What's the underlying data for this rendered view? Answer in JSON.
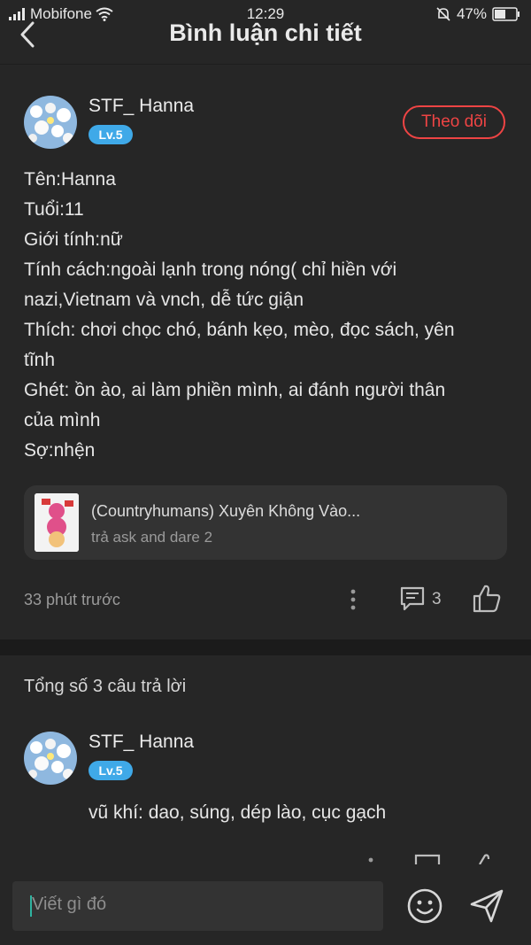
{
  "status_bar": {
    "carrier": "Mobifone",
    "time": "12:29",
    "battery": "47%"
  },
  "header": {
    "title": "Bình luận chi tiết"
  },
  "comment": {
    "user": {
      "name": "STF_ Hanna",
      "level": "Lv.5"
    },
    "follow_label": "Theo dõi",
    "lines": [
      "Tên:Hanna",
      "Tuổi:11",
      "Giới tính:nữ",
      "Tính cách:ngoài lạnh trong nóng( chỉ hiền với",
      "nazi,Vietnam và vnch, dễ tức giận",
      "Thích: chơi chọc chó, bánh kẹo, mèo, đọc sách, yên",
      "tĩnh",
      "Ghét: ồn ào, ai làm phiền mình, ai đánh người thân",
      "của mình",
      "Sợ:nhện"
    ],
    "story_card": {
      "title": "(Countryhumans) Xuyên Không Vào...",
      "subtitle": "trả ask and dare 2"
    },
    "time": "33 phút trước",
    "comment_count": "3"
  },
  "replies": {
    "total_label": "Tổng số 3 câu trả lời",
    "items": [
      {
        "name": "STF_ Hanna",
        "level": "Lv.5",
        "text": "vũ khí: dao, súng, dép lào, cục gạch"
      }
    ]
  },
  "composer": {
    "placeholder": "Viết gì đó"
  },
  "colors": {
    "background": "#262626",
    "accent_red": "#ee4444",
    "level_blue": "#3fa9e8"
  }
}
